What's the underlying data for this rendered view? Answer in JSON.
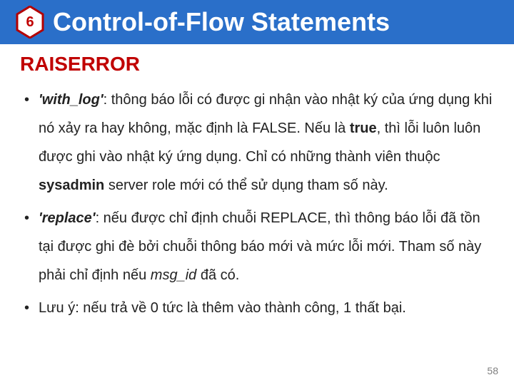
{
  "header": {
    "number": "6",
    "title": "Control-of-Flow Statements"
  },
  "subheading": "RAISERROR",
  "bullets": [
    {
      "lead": "'with_log'",
      "after_lead": ": thông báo lỗi có được gi nhận vào nhật ký của ứng dụng khi nó xảy ra hay không, mặc định là FALSE. Nếu là ",
      "mid_bold": "true",
      "after_mid": ", thì lỗi luôn luôn được ghi vào nhật ký ứng dụng. Chỉ có những thành viên thuộc ",
      "bold2": "sysadmin",
      "tail": " server role mới có thể sử dụng tham số này."
    },
    {
      "lead": "'replace'",
      "after_lead": ": nếu được chỉ định chuỗi REPLACE, thì thông báo lỗi đã tồn tại được ghi đè bởi chuỗi thông báo mới và mức lỗi mới. Tham số này phải chỉ định nếu ",
      "italic1": "msg_id",
      "tail": " đã có."
    },
    {
      "plain": "Lưu ý: nếu trả về 0 tức là thêm vào thành công, 1 thất bại."
    }
  ],
  "page_number": "58"
}
